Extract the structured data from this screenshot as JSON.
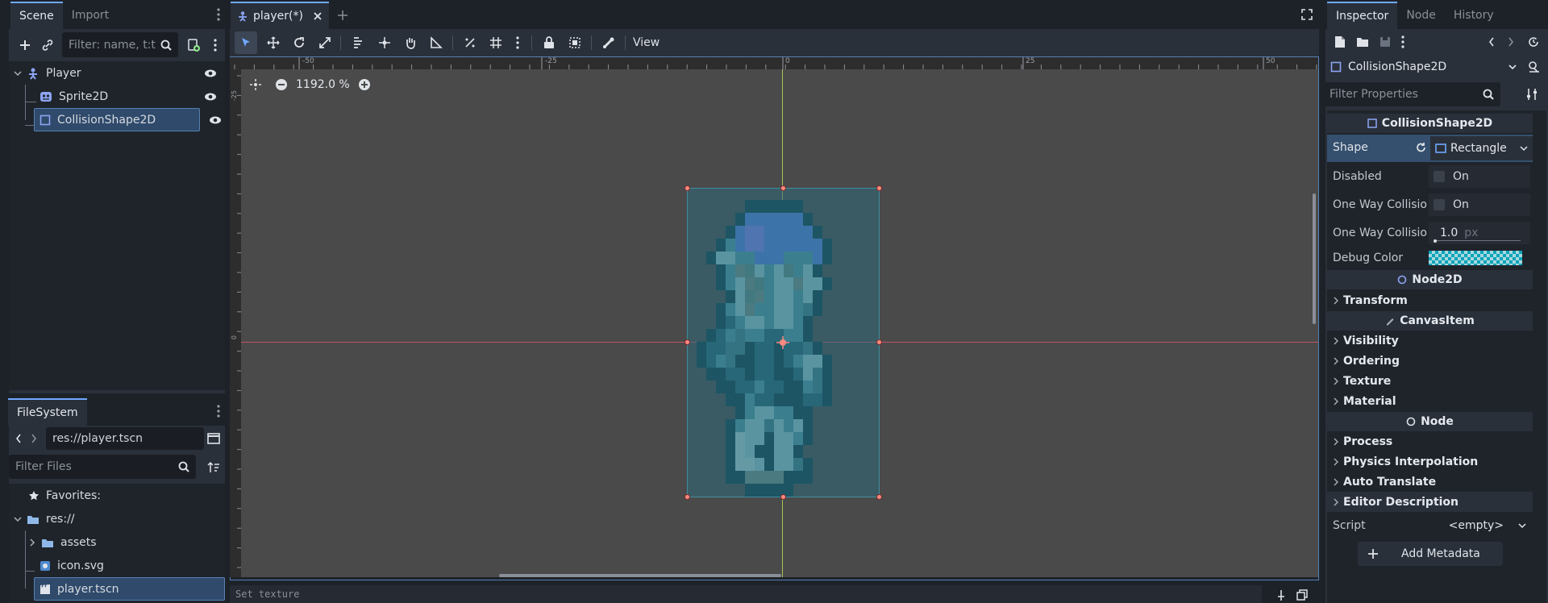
{
  "scene_dock": {
    "tabs": [
      "Scene",
      "Import"
    ],
    "filter_placeholder": "Filter: name, t:t",
    "nodes": [
      {
        "label": "Player",
        "icon": "player-node-icon"
      },
      {
        "label": "Sprite2D",
        "icon": "sprite2d-icon"
      },
      {
        "label": "CollisionShape2D",
        "icon": "collisionshape2d-icon"
      }
    ]
  },
  "filesystem": {
    "tab": "FileSystem",
    "path": "res://player.tscn",
    "filter_placeholder": "Filter Files",
    "items": [
      {
        "label": "Favorites:",
        "icon": "star-icon"
      },
      {
        "label": "res://",
        "icon": "folder-icon"
      },
      {
        "label": "assets",
        "icon": "folder-icon"
      },
      {
        "label": "icon.svg",
        "icon": "svg-file-icon"
      },
      {
        "label": "player.tscn",
        "icon": "scene-file-icon"
      }
    ]
  },
  "editor": {
    "scene_tab": "player(*)",
    "view_menu": "View",
    "zoom": "1192.0 %",
    "ruler_labels": [
      "-50",
      "-25",
      "0",
      "25",
      "50"
    ],
    "ruler_v_labels": [
      "-25",
      "0"
    ],
    "status_text": "Set texture"
  },
  "inspector": {
    "tabs": [
      "Inspector",
      "Node",
      "History"
    ],
    "selected_node": "CollisionShape2D",
    "filter_placeholder": "Filter Properties",
    "class_header": "CollisionShape2D",
    "shape_label": "Shape",
    "shape_value": "Rectangle",
    "disabled_label": "Disabled",
    "disabled_value": "On",
    "one_way_label": "One Way Collisio",
    "one_way_value": "On",
    "one_way_margin_label": "One Way Collisio",
    "one_way_margin_value": "1.0",
    "one_way_margin_unit": "px",
    "debug_color_label": "Debug Color",
    "node2d_header": "Node2D",
    "transform": "Transform",
    "canvasitem_header": "CanvasItem",
    "visibility": "Visibility",
    "ordering": "Ordering",
    "texture": "Texture",
    "material": "Material",
    "node_header": "Node",
    "process": "Process",
    "physics_interp": "Physics Interpolation",
    "auto_translate": "Auto Translate",
    "editor_description": "Editor Description",
    "script_label": "Script",
    "script_value": "<empty>",
    "add_metadata": "Add Metadata"
  },
  "colors": {
    "accent": "#6fa8ff",
    "canvas_bg": "#4a4a4a",
    "shape_fill": "#2e6a7a",
    "x_axis": "#c0526b",
    "y_axis": "#a6c45a"
  }
}
